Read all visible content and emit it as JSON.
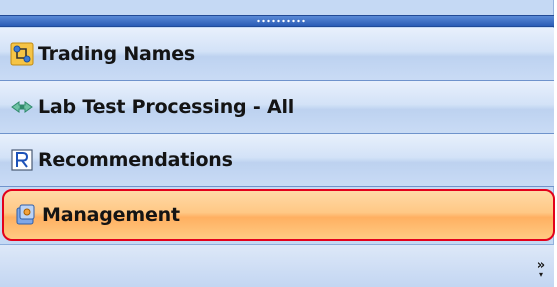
{
  "navigation_pane": {
    "items": [
      {
        "label": "Trading Names",
        "icon": "trading-names-icon",
        "selected": false
      },
      {
        "label": "Lab Test Processing - All",
        "icon": "lab-test-icon",
        "selected": false
      },
      {
        "label": "Recommendations",
        "icon": "recommendations-icon",
        "selected": false
      },
      {
        "label": "Management",
        "icon": "management-icon",
        "selected": true
      }
    ],
    "overflow_button": {
      "icon": "chevron-right-double-icon",
      "symbol": "»",
      "caret": "▾"
    },
    "colors": {
      "pane_background": "#c5d9f4",
      "selected_background": "#ffc885",
      "highlight_border": "#e3001b",
      "grip_bar": "#2a5cb6"
    }
  }
}
